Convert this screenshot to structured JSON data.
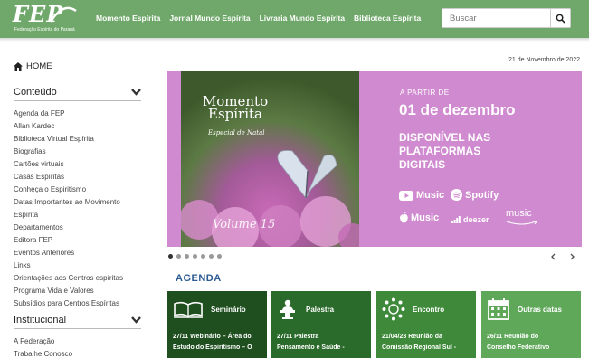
{
  "header": {
    "logo_text": "FEP",
    "logo_subtitle": "Federação Espírita do Paraná",
    "nav": [
      "Momento Espírita",
      "Jornal Mundo Espírita",
      "Livraria Mundo Espírita",
      "Biblioteca Espírita"
    ],
    "search_placeholder": "Buscar"
  },
  "sidebar": {
    "home_label": "HOME",
    "conteudo_title": "Conteúdo",
    "conteudo_items": [
      "Agenda da FEP",
      "Allan Kardec",
      "Biblioteca Virtual Espírita",
      "Biografias",
      "Cartões virtuais",
      "Casas Espíritas",
      "Conheça o Espiritismo",
      "Datas Importantes ao Movimento",
      "Espírita",
      "Departamentos",
      "Editora FEP",
      "Eventos Anteriores",
      "Links",
      "Orientações aos Centros espíritas",
      "Programa Vida e Valores",
      "Subsídios para Centros Espíritas"
    ],
    "institucional_title": "Institucional",
    "institucional_items": [
      "A Federação",
      "Trabalhe Conosco"
    ]
  },
  "date": "21 de Novembro de 2022",
  "banner": {
    "photo_title_1": "Momento",
    "photo_title_2": "Espírita",
    "photo_subtitle": "Especial de Natal",
    "photo_volume": "Volume 15",
    "pre": "A PARTIR DE",
    "date": "01 de dezembro",
    "available_1": "DISPONÍVEL NAS",
    "available_2": "PLATAFORMAS",
    "available_3": "DIGITAIS",
    "platforms": [
      "Music",
      "Spotify",
      "Music",
      "deezer",
      "music"
    ]
  },
  "carousel": {
    "slides": 7,
    "active": 0
  },
  "agenda": {
    "title": "AGENDA",
    "cards": [
      {
        "label": "Seminário",
        "text_1": "27/11 Webinário – Área do",
        "text_2": "Estudo do Espiritismo – O",
        "color": "#1f4f1f"
      },
      {
        "label": "Palestra",
        "text_1": "27/11 Palestra",
        "text_2": "Pensamento e Saúde -",
        "color": "#2a6a2a"
      },
      {
        "label": "Encontro",
        "text_1": "21/04/23 Reunião da",
        "text_2": "Comissão Regional Sul -",
        "color": "#3f8a3a"
      },
      {
        "label": "Outras datas",
        "text_1": "26/11 Reunião do",
        "text_2": "Conselho Federativo",
        "color": "#5fa85a"
      }
    ]
  }
}
